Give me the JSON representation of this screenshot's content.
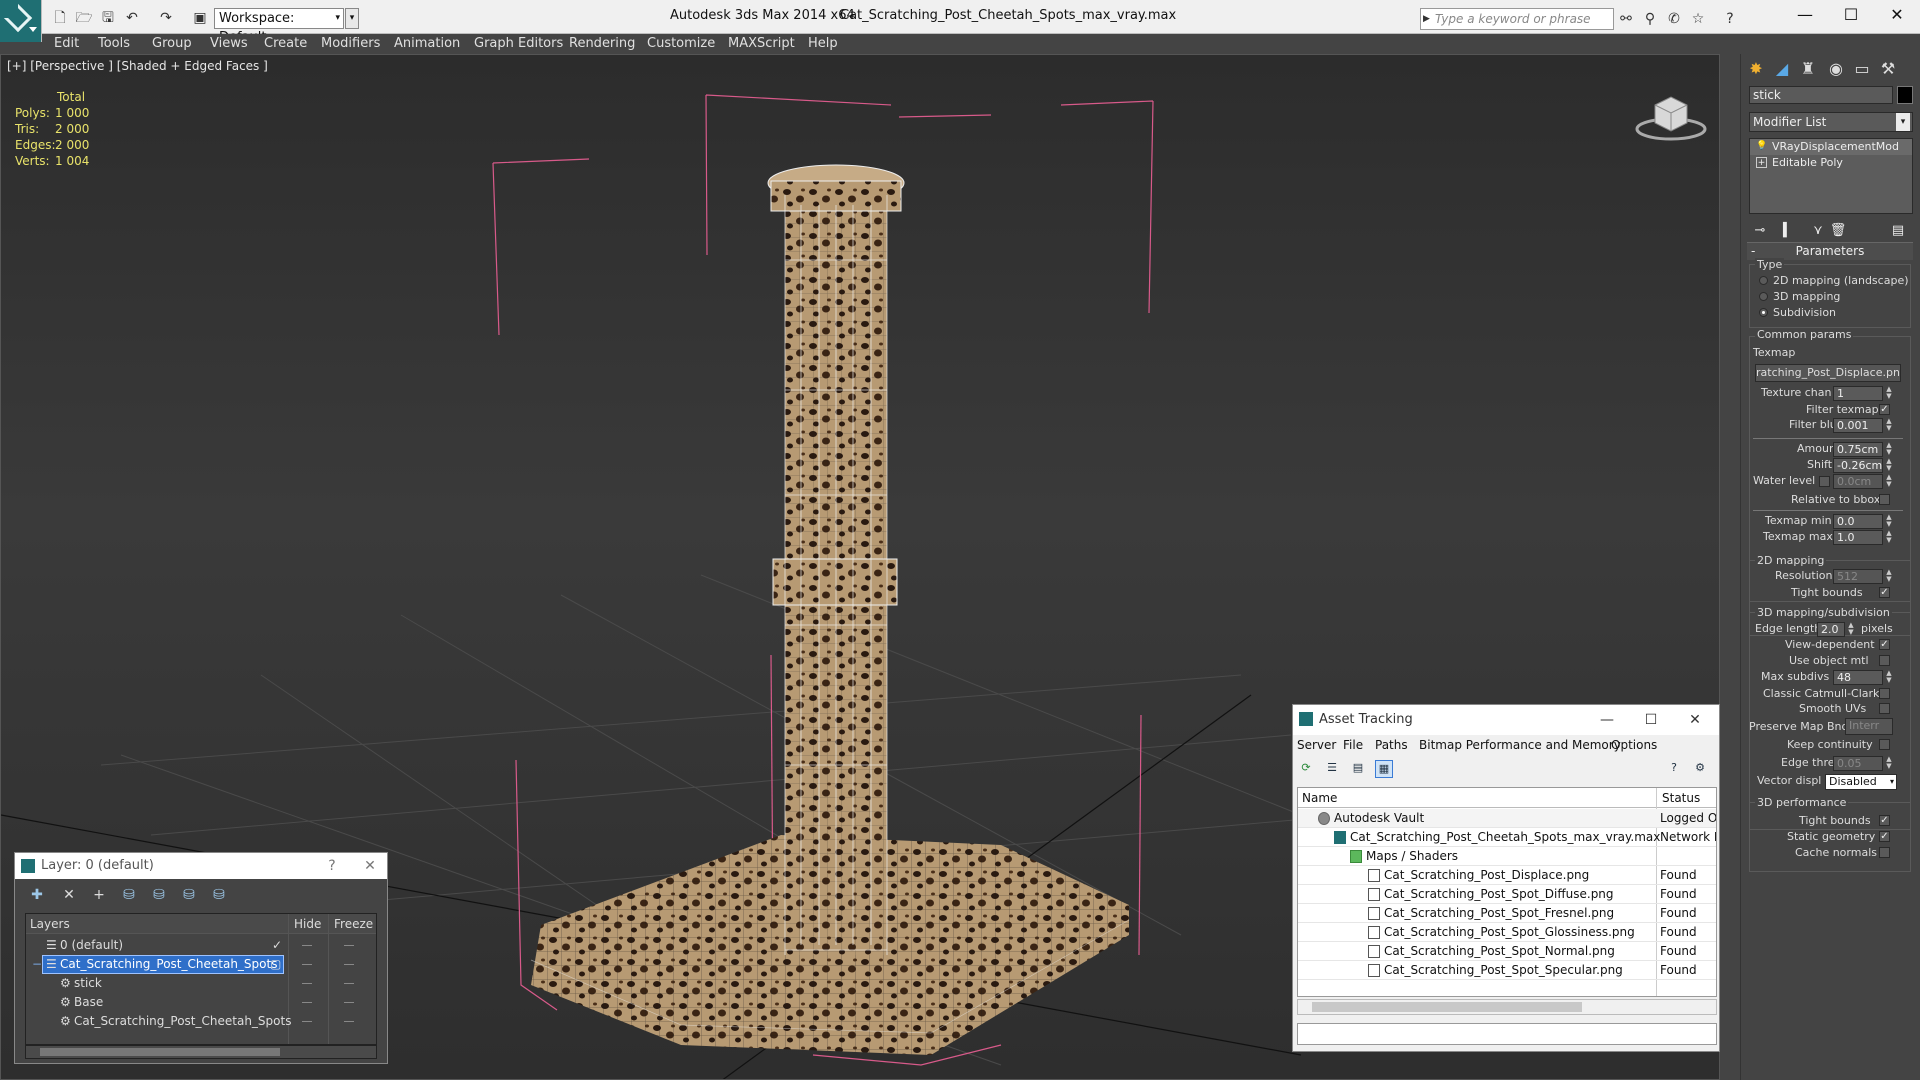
{
  "titlebar": {
    "workspace": "Workspace: Default",
    "app_title": "Autodesk 3ds Max  2014 x64",
    "file_title": "Cat_Scratching_Post_Cheetah_Spots_max_vray.max",
    "search_placeholder": "Type a keyword or phrase"
  },
  "menu": [
    "Edit",
    "Tools",
    "Group",
    "Views",
    "Create",
    "Modifiers",
    "Animation",
    "Graph Editors",
    "Rendering",
    "Customize",
    "MAXScript",
    "Help"
  ],
  "viewport": {
    "label": "[+] [Perspective ] [Shaded + Edged Faces ]",
    "stats_header": "Total",
    "stats": [
      {
        "k": "Polys:",
        "v": "1 000"
      },
      {
        "k": "Tris:",
        "v": "2 000"
      },
      {
        "k": "Edges:",
        "v": "2 000"
      },
      {
        "k": "Verts:",
        "v": "1 004"
      }
    ]
  },
  "command_panel": {
    "object_name": "stick",
    "modifier_list": "Modifier List",
    "stack": [
      "VRayDisplacementMod",
      "Editable Poly"
    ],
    "rollout_title": "Parameters",
    "type_group": "Type",
    "type_options": [
      "2D mapping (landscape)",
      "3D mapping",
      "Subdivision"
    ],
    "common_params": "Common params",
    "texmap_label": "Texmap",
    "texmap_value": "ratching_Post_Displace.png)",
    "texture_chan_label": "Texture chan",
    "texture_chan_value": "1",
    "filter_texmap_label": "Filter texmap",
    "filter_blur_label": "Filter blur",
    "filter_blur_value": "0.001",
    "amount_label": "Amount",
    "amount_value": "0.75cm",
    "shift_label": "Shift",
    "shift_value": "-0.26cm",
    "water_level_label": "Water level",
    "water_level_value": "0.0cm",
    "relative_bbox_label": "Relative to bbox",
    "texmap_min_label": "Texmap min",
    "texmap_min_value": "0.0",
    "texmap_max_label": "Texmap max",
    "texmap_max_value": "1.0",
    "mapping2d_group": "2D mapping",
    "resolution_label": "Resolution",
    "resolution_value": "512",
    "tight_bounds_label": "Tight bounds",
    "mapping3d_group": "3D mapping/subdivision",
    "edge_length_label": "Edge length",
    "edge_length_value": "2.0",
    "pixels_label": "pixels",
    "view_dependent_label": "View-dependent",
    "use_object_mtl_label": "Use object mtl",
    "max_subdivs_label": "Max subdivs",
    "max_subdivs_value": "48",
    "classic_catmull_label": "Classic Catmull-Clark",
    "smooth_uvs_label": "Smooth UVs",
    "preserve_map_label": "Preserve Map Bnd",
    "preserve_map_value": "Interr",
    "keep_continuity_label": "Keep continuity",
    "edge_thresh_label": "Edge thresh",
    "edge_thresh_value": "0.05",
    "vector_displ_label": "Vector displ",
    "vector_displ_value": "Disabled",
    "perf_group": "3D performance",
    "perf_tight_bounds_label": "Tight bounds",
    "static_geometry_label": "Static geometry",
    "cache_normals_label": "Cache normals"
  },
  "asset_tracking": {
    "title": "Asset Tracking",
    "menu": [
      "Server",
      "File",
      "Paths",
      "Bitmap Performance and Memory",
      "Options"
    ],
    "col_name": "Name",
    "col_status": "Status",
    "rows": [
      {
        "name": "Autodesk Vault",
        "status": "Logged O"
      },
      {
        "name": "Cat_Scratching_Post_Cheetah_Spots_max_vray.max",
        "status": "Network F"
      },
      {
        "name": "Maps / Shaders",
        "status": ""
      },
      {
        "name": "Cat_Scratching_Post_Displace.png",
        "status": "Found"
      },
      {
        "name": "Cat_Scratching_Post_Spot_Diffuse.png",
        "status": "Found"
      },
      {
        "name": "Cat_Scratching_Post_Spot_Fresnel.png",
        "status": "Found"
      },
      {
        "name": "Cat_Scratching_Post_Spot_Glossiness.png",
        "status": "Found"
      },
      {
        "name": "Cat_Scratching_Post_Spot_Normal.png",
        "status": "Found"
      },
      {
        "name": "Cat_Scratching_Post_Spot_Specular.png",
        "status": "Found"
      }
    ]
  },
  "layer_window": {
    "title": "Layer: 0 (default)",
    "help": "?",
    "col_layers": "Layers",
    "col_hide": "Hide",
    "col_freeze": "Freeze",
    "rows": [
      {
        "name": "0 (default)"
      },
      {
        "name": "Cat_Scratching_Post_Cheetah_Spots"
      },
      {
        "name": "stick"
      },
      {
        "name": "Base"
      },
      {
        "name": "Cat_Scratching_Post_Cheetah_Spots"
      }
    ]
  }
}
